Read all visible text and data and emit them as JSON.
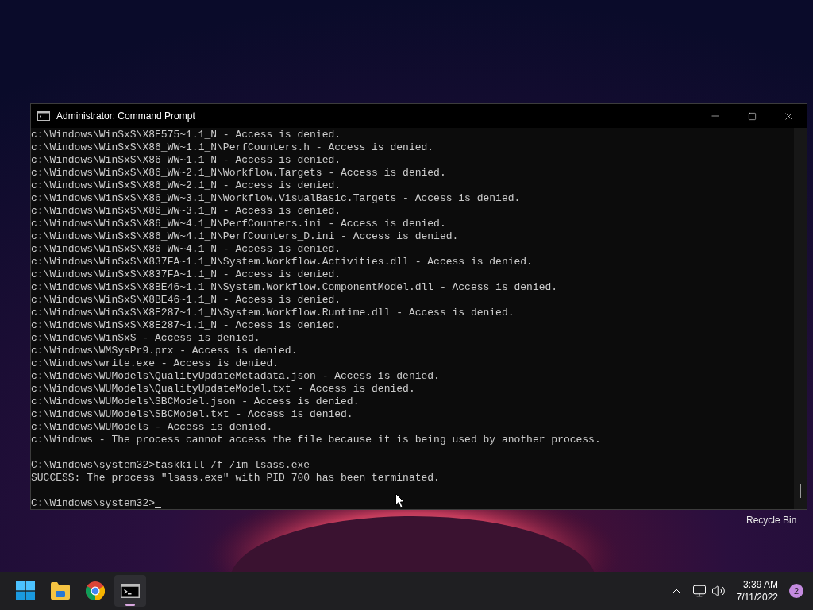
{
  "desktop": {
    "icons": [
      {
        "label": "Recycle Bin"
      }
    ]
  },
  "window": {
    "title": "Administrator: Command Prompt",
    "blocks": [
      {
        "lines": [
          "c:\\Windows\\WinSxS\\X8E575~1.1_N - Access is denied.",
          "c:\\Windows\\WinSxS\\X86_WW~1.1_N\\PerfCounters.h - Access is denied.",
          "c:\\Windows\\WinSxS\\X86_WW~1.1_N - Access is denied.",
          "c:\\Windows\\WinSxS\\X86_WW~2.1_N\\Workflow.Targets - Access is denied.",
          "c:\\Windows\\WinSxS\\X86_WW~2.1_N - Access is denied.",
          "c:\\Windows\\WinSxS\\X86_WW~3.1_N\\Workflow.VisualBasic.Targets - Access is denied.",
          "c:\\Windows\\WinSxS\\X86_WW~3.1_N - Access is denied.",
          "c:\\Windows\\WinSxS\\X86_WW~4.1_N\\PerfCounters.ini - Access is denied.",
          "c:\\Windows\\WinSxS\\X86_WW~4.1_N\\PerfCounters_D.ini - Access is denied.",
          "c:\\Windows\\WinSxS\\X86_WW~4.1_N - Access is denied.",
          "c:\\Windows\\WinSxS\\X837FA~1.1_N\\System.Workflow.Activities.dll - Access is denied.",
          "c:\\Windows\\WinSxS\\X837FA~1.1_N - Access is denied.",
          "c:\\Windows\\WinSxS\\X8BE46~1.1_N\\System.Workflow.ComponentModel.dll - Access is denied.",
          "c:\\Windows\\WinSxS\\X8BE46~1.1_N - Access is denied.",
          "c:\\Windows\\WinSxS\\X8E287~1.1_N\\System.Workflow.Runtime.dll - Access is denied.",
          "c:\\Windows\\WinSxS\\X8E287~1.1_N - Access is denied.",
          "c:\\Windows\\WinSxS - Access is denied.",
          "c:\\Windows\\WMSysPr9.prx - Access is denied.",
          "c:\\Windows\\write.exe - Access is denied.",
          "c:\\Windows\\WUModels\\QualityUpdateMetadata.json - Access is denied.",
          "c:\\Windows\\WUModels\\QualityUpdateModel.txt - Access is denied.",
          "c:\\Windows\\WUModels\\SBCModel.json - Access is denied.",
          "c:\\Windows\\WUModels\\SBCModel.txt - Access is denied.",
          "c:\\Windows\\WUModels - Access is denied.",
          "c:\\Windows - The process cannot access the file because it is being used by another process."
        ]
      },
      {
        "lines": [
          "C:\\Windows\\system32>taskkill /f /im lsass.exe",
          "SUCCESS: The process \"lsass.exe\" with PID 700 has been terminated."
        ]
      },
      {
        "lines": [
          "C:\\Windows\\system32>"
        ],
        "cursor": true
      }
    ]
  },
  "taskbar": {
    "apps": [
      {
        "kind": "start",
        "selected": false
      },
      {
        "kind": "folder",
        "selected": false
      },
      {
        "kind": "browser",
        "selected": false
      },
      {
        "kind": "terminal",
        "selected": true
      }
    ],
    "tray": {
      "time": "3:39 AM",
      "date": "7/11/2022",
      "notifications": "2"
    }
  }
}
